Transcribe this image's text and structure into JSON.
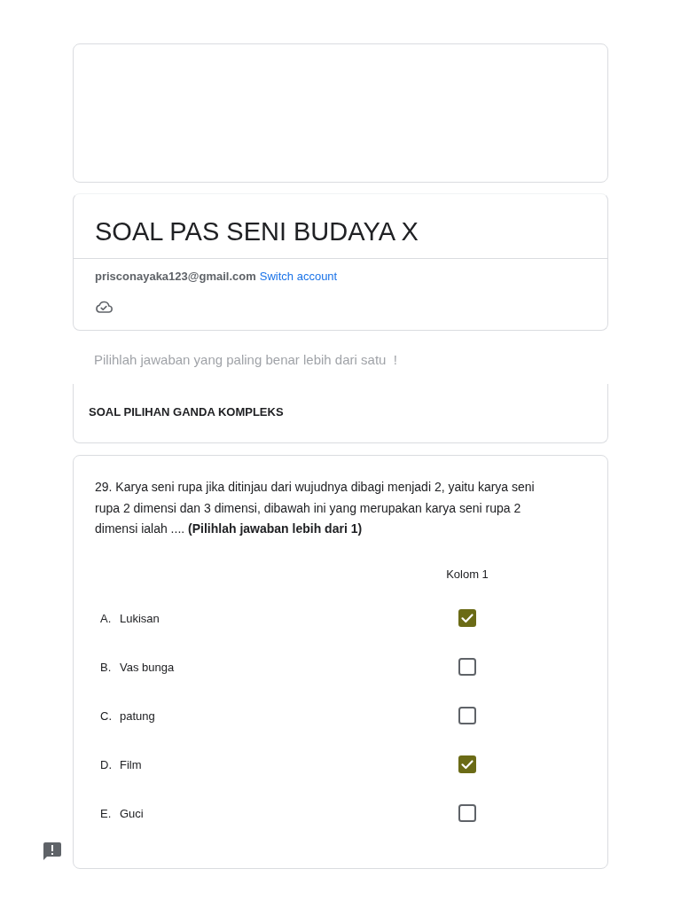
{
  "form": {
    "title": "SOAL PAS SENI BUDAYA X",
    "account": {
      "email": "prisconayaka123@gmail.com",
      "link": "Switch account"
    }
  },
  "description": "Pilihlah jawaban yang paling benar lebih dari satu  !",
  "section": {
    "title": "SOAL PILIHAN GANDA KOMPLEKS"
  },
  "question": {
    "text": "29. Karya seni rupa jika ditinjau dari wujudnya dibagi menjadi 2, yaitu karya seni rupa 2 dimensi dan 3 dimensi, dibawah ini yang merupakan karya seni rupa 2 dimensi ialah .... **(Pilihlah jawaban lebih dari 1)**",
    "columns": [
      "Kolom 1"
    ],
    "rows": [
      {
        "letter": "A.",
        "label": "Lukisan",
        "checked": true
      },
      {
        "letter": "B.",
        "label": "Vas bunga",
        "checked": false
      },
      {
        "letter": "C.",
        "label": "patung",
        "checked": false
      },
      {
        "letter": "D.",
        "label": "Film",
        "checked": true
      },
      {
        "letter": "E.",
        "label": "Guci",
        "checked": false
      }
    ]
  }
}
